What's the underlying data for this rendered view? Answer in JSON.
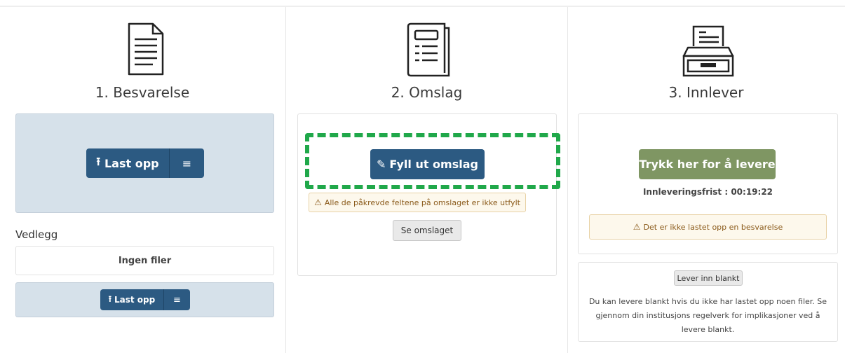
{
  "steps": [
    {
      "title": "1. Besvarelse",
      "icon": "document-icon"
    },
    {
      "title": "2. Omslag",
      "icon": "cover-folder-icon"
    },
    {
      "title": "3. Innlever",
      "icon": "inbox-tray-icon"
    }
  ],
  "besvarelse": {
    "upload_label": "Last opp",
    "menu_icon": "≡",
    "upload_icon": "⭱",
    "vedlegg_title": "Vedlegg",
    "no_files": "Ingen filer",
    "vedlegg_upload_label": "Last opp"
  },
  "omslag": {
    "fill_label": "Fyll ut omslag",
    "pencil_icon": "✎",
    "warning_icon": "⚠",
    "warning_text": "Alle de påkrevde feltene på omslaget er ikke utfylt",
    "see_label": "Se omslaget"
  },
  "innlever": {
    "submit_label": "Trykk her for å levere",
    "deadline_text": "Innleveringsfrist : 00:19:22",
    "warning_icon": "⚠",
    "warning_text": "Det er ikke lastet opp en besvarelse",
    "blank_label": "Lever inn blankt",
    "blank_info": "Du kan levere blankt hvis du ikke har lastet opp noen filer. Se gjennom din institusjons regelverk for implikasjoner ved å levere blankt."
  },
  "colors": {
    "primary": "#2c5a82",
    "submit": "#7f9663",
    "upload_bg": "#d6e1ea",
    "highlight": "#20a84a"
  }
}
